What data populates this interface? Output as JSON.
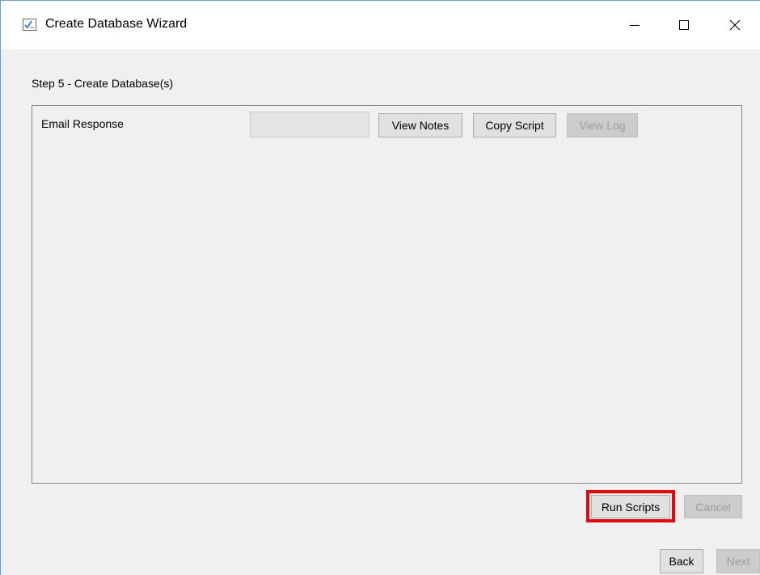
{
  "window": {
    "title": "Create Database Wizard",
    "icon": "wizard-checkbox-icon",
    "controls": {
      "minimize_icon": "minimize-icon",
      "maximize_icon": "maximize-icon",
      "close_icon": "close-icon"
    }
  },
  "step": {
    "label": "Step 5 - Create Database(s)"
  },
  "databases": [
    {
      "name": "Email Response",
      "status": "",
      "buttons": {
        "view_notes": "View Notes",
        "copy_script": "Copy Script",
        "view_log": "View Log"
      },
      "view_log_enabled": false
    }
  ],
  "actions": {
    "run_scripts": "Run Scripts",
    "cancel": "Cancel",
    "cancel_enabled": false,
    "highlight_color": "#e8000b"
  },
  "navigation": {
    "back": "Back",
    "next": "Next",
    "next_enabled": false
  },
  "colors": {
    "window_border": "#6aa0d8",
    "client_background": "#f0f0f0",
    "button_face": "#e1e1e1",
    "disabled_text": "#9d9d9d"
  }
}
